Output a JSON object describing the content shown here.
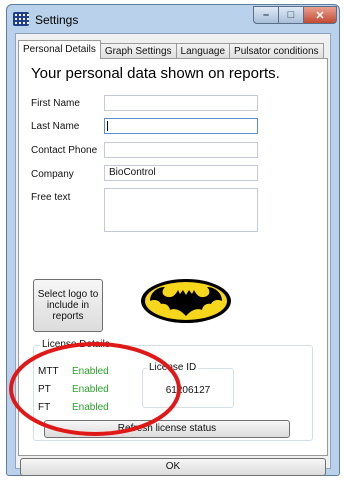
{
  "window": {
    "title": "Settings",
    "icon": "settings-grid-icon"
  },
  "tabs": [
    {
      "label": "Personal Details",
      "active": true
    },
    {
      "label": "Graph Settings",
      "active": false
    },
    {
      "label": "Language",
      "active": false
    },
    {
      "label": "Pulsator conditions",
      "active": false
    }
  ],
  "personal": {
    "heading": "Your personal data shown on reports.",
    "fields": {
      "first_name": {
        "label": "First Name",
        "value": ""
      },
      "last_name": {
        "label": "Last Name",
        "value": ""
      },
      "contact_phone": {
        "label": "Contact Phone",
        "value": ""
      },
      "company": {
        "label": "Company",
        "value": "BioControl"
      },
      "free_text": {
        "label": "Free text",
        "value": ""
      }
    },
    "logo_button": "Select logo to\ninclude in\nreports",
    "logo_image": "batman-logo"
  },
  "license": {
    "title": "License Details",
    "items": [
      {
        "name": "MTT",
        "status": "Enabled"
      },
      {
        "name": "PT",
        "status": "Enabled"
      },
      {
        "name": "FT",
        "status": "Enabled"
      }
    ],
    "id_title": "License ID",
    "id_value": "61206127",
    "refresh_button": "Refresh license status"
  },
  "footer": {
    "ok_button": "OK"
  },
  "colors": {
    "enabled": "#2aa32a",
    "annotation": "#e01818"
  }
}
